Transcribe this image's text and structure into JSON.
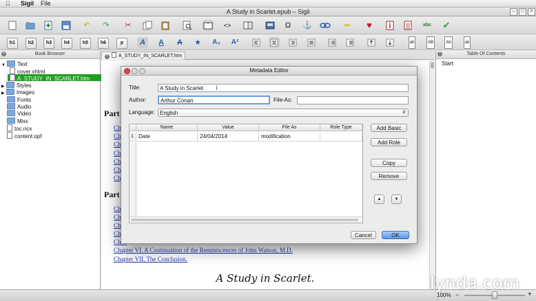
{
  "menubar": {
    "app_name": "Sigil",
    "menu_file": "File"
  },
  "window": {
    "title": "A Study in Scarlet.epub – Sigil"
  },
  "toolbar2": {
    "headings": [
      "h1",
      "h2",
      "h3",
      "h4",
      "h5",
      "h6",
      "p"
    ]
  },
  "book_browser": {
    "title": "Book Browser",
    "items": [
      "Text",
      "cover.xhtml",
      "A_STUDY_IN_SCARLET.htm",
      "Styles",
      "Images",
      "Fonts",
      "Audio",
      "Video",
      "Misc",
      "toc.ncx",
      "content.opf"
    ]
  },
  "editor_tab": {
    "label": "A_STUDY_IN_SCARLET.htm"
  },
  "toc_panel": {
    "title": "Table Of Contents",
    "items": [
      "Start"
    ]
  },
  "document": {
    "part1_heading": "Part",
    "part2_heading": "Part",
    "links_part1": [
      "Chap",
      "Chap",
      "Chap",
      "Chap",
      "Chap",
      "Chap",
      "Chap"
    ],
    "links_part2": [
      "Chap",
      "Chap",
      "Chap",
      "Chap",
      "Chap"
    ],
    "link_chapter6": "Chapter VI. A Continuation of the Reminiscences of John Watson, M.D.",
    "link_chapter7": "Chapter VII. The Conclusion.",
    "book_title": "A Study in Scarlet."
  },
  "metadata_editor": {
    "title": "Metadata Editor",
    "title_label": "Title:",
    "title_value": "A Study in Scarlet",
    "author_label": "Author:",
    "author_value": "Arthur Conan",
    "file_as_label": "File-As:",
    "file_as_value": "",
    "language_label": "Language:",
    "language_value": "English",
    "table_headers": [
      "Name",
      "Value",
      "File As",
      "Role Type"
    ],
    "rows": [
      {
        "index": "1",
        "name": "Date",
        "value": "24/04/2014",
        "file_as": "modification",
        "role_type": ""
      }
    ],
    "buttons": {
      "add_basic": "Add Basic",
      "add_role": "Add Role",
      "copy": "Copy",
      "remove": "Remove",
      "up": "▲",
      "down": "▼",
      "cancel": "Cancel",
      "ok": "OK"
    }
  },
  "statusbar": {
    "zoom": "100%"
  },
  "watermark": "lynda.com",
  "colors": {
    "selection": "#1f9f1f",
    "link": "#1a2fb0",
    "ok_button": "#7fb0f0"
  }
}
